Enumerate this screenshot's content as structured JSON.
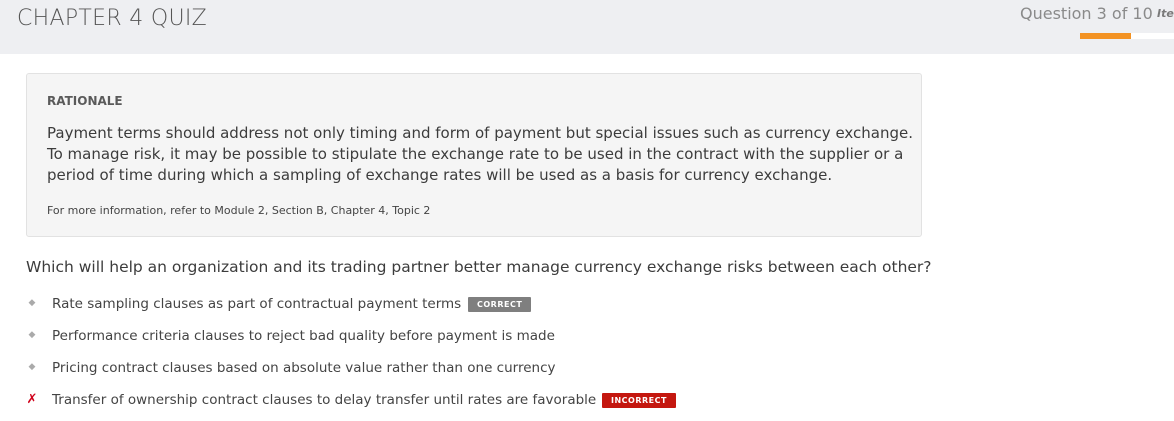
{
  "header": {
    "title": "CHAPTER 4 QUIZ",
    "progress_text": "Question 3 of 10",
    "item_ref": "Ite",
    "progress_fraction": 0.3,
    "accent_color": "#f39223"
  },
  "rationale": {
    "label": "RATIONALE",
    "body": "Payment terms should address not only timing and form of payment but special issues such as currency exchange. To manage risk, it may be possible to stipulate the exchange rate to be used in the contract with the supplier or a period of time during which a sampling of exchange rates will be used as a basis for currency exchange.",
    "reference": "For more information, refer to Module 2, Section B, Chapter 4, Topic 2"
  },
  "question": {
    "text": "Which will help an organization and its trading partner better manage currency exchange risks between each other?"
  },
  "answers": [
    {
      "marker": "◆",
      "text": "Rate sampling clauses as part of contractual payment terms",
      "badge": "CORRECT",
      "badge_color": "#7f7f7f"
    },
    {
      "marker": "◆",
      "text": "Performance criteria clauses to reject bad quality before payment is made",
      "badge": "",
      "badge_color": ""
    },
    {
      "marker": "◆",
      "text": "Pricing contract clauses based on absolute value rather than one currency",
      "badge": "",
      "badge_color": ""
    },
    {
      "marker": "✗",
      "text": "Transfer of ownership contract clauses to delay transfer until rates are favorable",
      "badge": "INCORRECT",
      "badge_color": "#c4170f"
    }
  ]
}
